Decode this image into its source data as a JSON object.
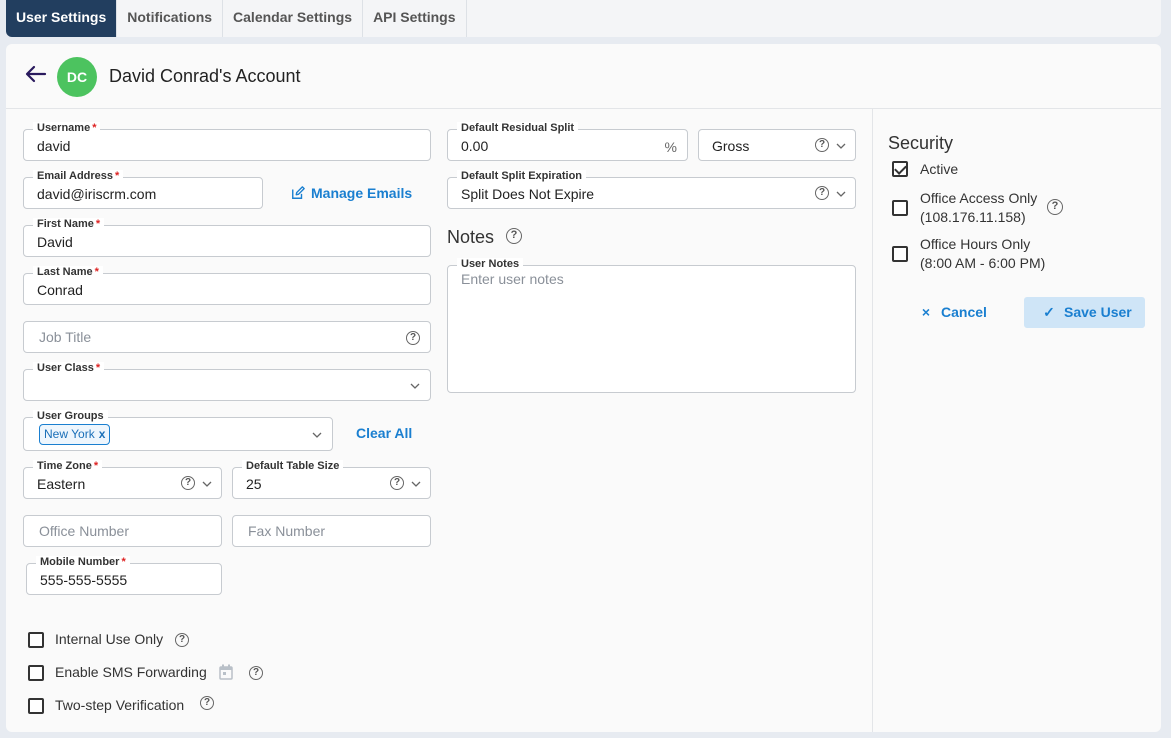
{
  "tabs": [
    {
      "label": "User Settings",
      "active": true
    },
    {
      "label": "Notifications",
      "active": false
    },
    {
      "label": "Calendar Settings",
      "active": false
    },
    {
      "label": "API Settings",
      "active": false
    }
  ],
  "header": {
    "avatar_initials": "DC",
    "avatar_color": "#4cc35f",
    "title": "David Conrad's Account"
  },
  "form": {
    "username": {
      "label": "Username",
      "value": "david"
    },
    "email": {
      "label": "Email Address",
      "value": "david@iriscrm.com"
    },
    "manage_emails": "Manage Emails",
    "first_name": {
      "label": "First Name",
      "value": "David"
    },
    "last_name": {
      "label": "Last Name",
      "value": "Conrad"
    },
    "job_title": {
      "placeholder": "Job Title"
    },
    "user_class": {
      "label": "User Class",
      "value": ""
    },
    "user_groups": {
      "label": "User Groups",
      "chips": [
        "New York"
      ]
    },
    "clear_all": "Clear All",
    "time_zone": {
      "label": "Time Zone",
      "value": "Eastern"
    },
    "table_size": {
      "label": "Default Table Size",
      "value": "25"
    },
    "office_number": {
      "placeholder": "Office Number"
    },
    "fax_number": {
      "placeholder": "Fax Number"
    },
    "mobile_number": {
      "label": "Mobile Number",
      "value": "555-555-5555"
    },
    "required_marker": "*",
    "options": [
      {
        "label": "Internal Use Only",
        "checked": false
      },
      {
        "label": "Enable SMS Forwarding",
        "checked": false
      },
      {
        "label": "Two-step Verification",
        "checked": false
      }
    ]
  },
  "split": {
    "residual": {
      "label": "Default Residual Split",
      "value": "0.00",
      "suffix": "%"
    },
    "basis": {
      "value": "Gross"
    },
    "expiration": {
      "label": "Default Split Expiration",
      "value": "Split Does Not Expire"
    }
  },
  "notes": {
    "title": "Notes",
    "label": "User Notes",
    "placeholder": "Enter user notes"
  },
  "security": {
    "title": "Security",
    "options": [
      {
        "label": "Active",
        "checked": true
      },
      {
        "label": "Office Access Only",
        "sub": "(108.176.11.158)",
        "checked": false
      },
      {
        "label": "Office Hours Only",
        "sub": "(8:00 AM - 6:00 PM)",
        "checked": false
      }
    ],
    "cancel": "Cancel",
    "save": "Save User"
  },
  "icons": {
    "help": "?",
    "close": "×",
    "check": "✓",
    "chip_remove": "x"
  },
  "accent_color": "#1a7fd0",
  "tab_active_color": "#223e5f"
}
